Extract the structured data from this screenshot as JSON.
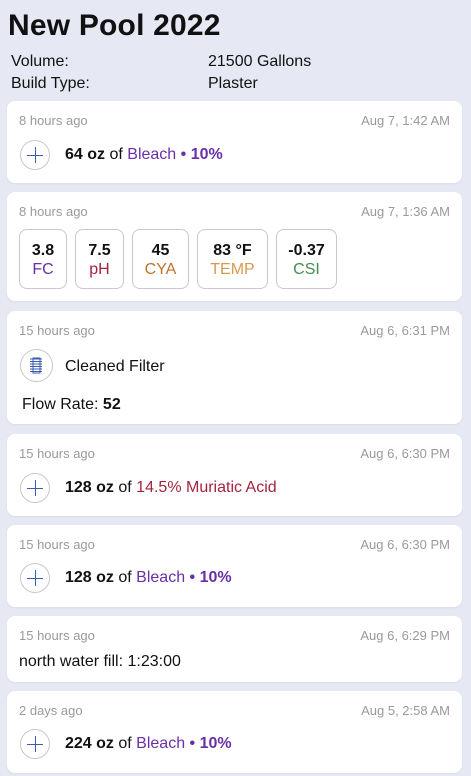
{
  "header": {
    "title": "New Pool 2022",
    "volume_label": "Volume:",
    "volume_value": "21500 Gallons",
    "build_label": "Build Type:",
    "build_value": "Plaster"
  },
  "entries": [
    {
      "ago": "8 hours ago",
      "ts": "Aug 7, 1:42 AM",
      "amount": "64 oz",
      "of": "of",
      "chemical": "Bleach",
      "sep": "•",
      "strength": "10%"
    },
    {
      "ago": "8 hours ago",
      "ts": "Aug 7, 1:36 AM",
      "tiles": [
        {
          "value": "3.8",
          "label": "FC",
          "color": "#6a2fa7"
        },
        {
          "value": "7.5",
          "label": "pH",
          "color": "#a4243e"
        },
        {
          "value": "45",
          "label": "CYA",
          "color": "#c0722b"
        },
        {
          "value": "83 °F",
          "label": "TEMP",
          "color": "#d99a4f"
        },
        {
          "value": "-0.37",
          "label": "CSI",
          "color": "#3f8f4f"
        }
      ]
    },
    {
      "ago": "15 hours ago",
      "ts": "Aug 6, 6:31 PM",
      "action": "Cleaned Filter",
      "flow_label": "Flow Rate:",
      "flow_value": "52"
    },
    {
      "ago": "15 hours ago",
      "ts": "Aug 6, 6:30 PM",
      "amount": "128 oz",
      "of": "of",
      "chemical": "14.5% Muriatic Acid"
    },
    {
      "ago": "15 hours ago",
      "ts": "Aug 6, 6:30 PM",
      "amount": "128 oz",
      "of": "of",
      "chemical": "Bleach",
      "sep": "•",
      "strength": "10%"
    },
    {
      "ago": "15 hours ago",
      "ts": "Aug 6, 6:29 PM",
      "note": "north water fill: 1:23:00"
    },
    {
      "ago": "2 days ago",
      "ts": "Aug 5, 2:58 AM",
      "amount": "224 oz",
      "of": "of",
      "chemical": "Bleach",
      "sep": "•",
      "strength": "10%"
    }
  ],
  "icons": {
    "add": "plus-circle-icon",
    "filter": "filter-icon"
  }
}
